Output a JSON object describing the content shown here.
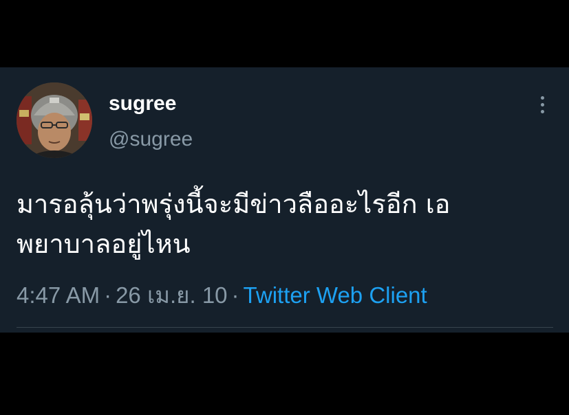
{
  "tweet": {
    "author": {
      "display_name": "sugree",
      "handle": "@sugree"
    },
    "text_line1": "มารอลุ้นว่าพรุ่งนี้จะมีข่าวลืออะไรอีก เอ",
    "text_line2": "พยาบาลอยู่ไหน",
    "time": "4:47 AM",
    "separator": "·",
    "date": "26 เม.ย. 10",
    "client": "Twitter Web Client"
  },
  "icons": {
    "more": "more-vertical-icon"
  },
  "colors": {
    "background": "#000000",
    "card": "#15202b",
    "primary_text": "#ffffff",
    "secondary_text": "#8899a6",
    "link": "#1da1f2",
    "divider": "#38444d"
  }
}
